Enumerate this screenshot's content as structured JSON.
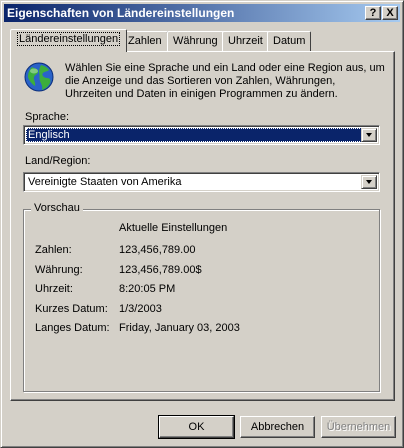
{
  "window": {
    "title": "Eigenschaften von Ländereinstellungen",
    "help_label": "?",
    "close_label": "X"
  },
  "tabs": [
    {
      "label": "Ländereinstellungen",
      "active": true
    },
    {
      "label": "Zahlen",
      "active": false
    },
    {
      "label": "Währung",
      "active": false
    },
    {
      "label": "Uhrzeit",
      "active": false
    },
    {
      "label": "Datum",
      "active": false
    }
  ],
  "intro_text": "Wählen Sie eine Sprache und ein Land oder eine Region aus, um die Anzeige und das Sortieren von Zahlen, Währungen, Uhrzeiten und Daten in einigen Programmen zu ändern.",
  "language": {
    "label": "Sprache:",
    "value": "Englisch"
  },
  "region": {
    "label": "Land/Region:",
    "value": "Vereinigte Staaten von Amerika"
  },
  "preview": {
    "legend": "Vorschau",
    "heading": "Aktuelle Einstellungen",
    "rows": [
      {
        "label": "Zahlen:",
        "value": "123,456,789.00"
      },
      {
        "label": "Währung:",
        "value": "123,456,789.00$"
      },
      {
        "label": "Uhrzeit:",
        "value": "8:20:05 PM"
      },
      {
        "label": "Kurzes Datum:",
        "value": "1/3/2003"
      },
      {
        "label": "Langes Datum:",
        "value": "Friday, January 03, 2003"
      }
    ]
  },
  "buttons": {
    "ok": "OK",
    "cancel": "Abbrechen",
    "apply": "Übernehmen"
  },
  "colors": {
    "title_start": "#0a246a",
    "title_end": "#a6caf0",
    "face": "#d4d0c8",
    "selection": "#0a246a"
  },
  "icons": {
    "globe": "globe-icon",
    "dropdown": "chevron-down-icon"
  }
}
